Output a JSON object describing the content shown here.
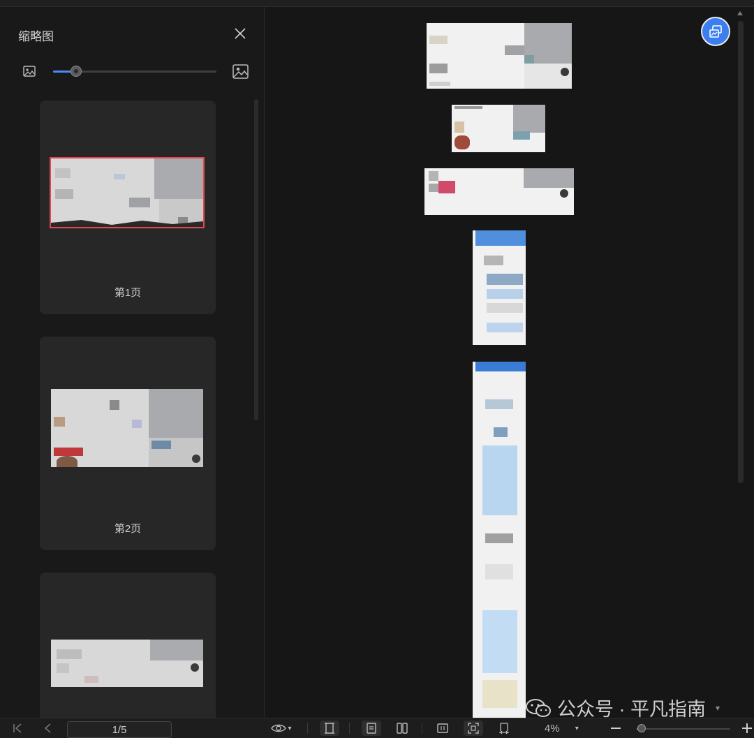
{
  "sidebar": {
    "title": "缩略图",
    "close_icon": "close-icon",
    "size_slider": {
      "value": 0.14
    },
    "pages": [
      {
        "label": "第1页",
        "selected": true
      },
      {
        "label": "第2页",
        "selected": false
      },
      {
        "label": "",
        "selected": false
      }
    ]
  },
  "main": {
    "page_count": 5,
    "fab_icon": "image-convert-icon"
  },
  "watermark": {
    "brand": "公众号 · 平凡指南",
    "icon": "wechat-icon"
  },
  "bottombar": {
    "page_indicator": "1/5",
    "zoom_value": "4%",
    "zoom_slider": {
      "value": 0.05
    },
    "icons": [
      "first-page-icon",
      "prev-page-icon",
      "eye-icon",
      "fit-height-icon",
      "single-page-icon",
      "two-page-icon",
      "actual-size-icon",
      "fit-screen-icon",
      "fit-width-icon",
      "zoom-out-icon",
      "zoom-in-icon"
    ]
  },
  "colors": {
    "accent": "#3b7ef0",
    "selection": "#e0494f",
    "background": "#171717"
  }
}
